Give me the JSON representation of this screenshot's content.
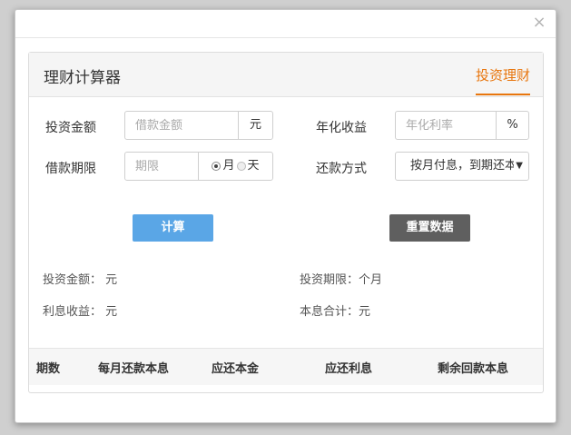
{
  "dialog": {
    "close_glyph": "×"
  },
  "panel": {
    "title": "理财计算器",
    "tab": "投资理财"
  },
  "form": {
    "amount": {
      "label": "投资金额",
      "placeholder": "借款金额",
      "unit": "元"
    },
    "rate": {
      "label": "年化收益",
      "placeholder": "年化利率",
      "unit": "%"
    },
    "term": {
      "label": "借款期限",
      "placeholder": "期限",
      "opt_month": "月",
      "opt_day": "天",
      "selected": "月"
    },
    "repay": {
      "label": "还款方式",
      "value": "按月付息，到期还本",
      "arrow": "▼"
    }
  },
  "buttons": {
    "calculate": "计算",
    "reset": "重置数据"
  },
  "summary": {
    "amount": "投资金额： 元",
    "period": "投资期限：个月",
    "interest": "利息收益： 元",
    "total": "本息合计：元"
  },
  "table": {
    "headers": [
      "期数",
      "每月还款本息",
      "应还本金",
      "应还利息",
      "剩余回款本息"
    ]
  },
  "icons": {
    "close": "close-icon",
    "select": "chevron-down-icon"
  }
}
